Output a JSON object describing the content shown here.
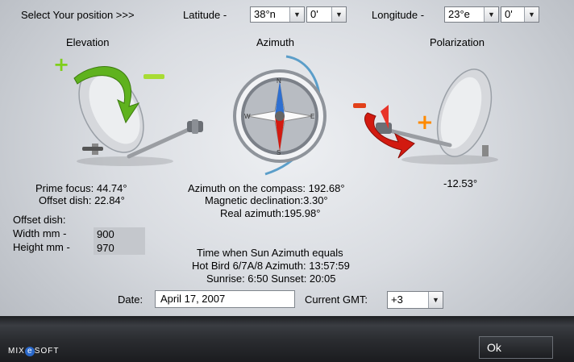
{
  "header": {
    "select_position": "Select Your position >>>",
    "latitude_label": "Latitude -",
    "latitude_deg": "38°n",
    "latitude_min": "0'",
    "longitude_label": "Longitude -",
    "longitude_deg": "23°e",
    "longitude_min": "0'"
  },
  "sections": {
    "elevation": "Elevation",
    "azimuth": "Azimuth",
    "polarization": "Polarization"
  },
  "elevation": {
    "prime_focus": "Prime focus: 44.74°",
    "offset_dish": "Offset dish: 22.84°",
    "plus": "+",
    "minus": "−"
  },
  "compass": {
    "n": "N",
    "s": "S",
    "e": "E",
    "w": "W"
  },
  "azimuth": {
    "compass": "Azimuth on the compass: 192.68°",
    "declination": "Magnetic declination:3.30°",
    "real": "Real azimuth:195.98°"
  },
  "polarization": {
    "value": "-12.53°",
    "plus": "+",
    "minus": "−"
  },
  "offset": {
    "title": "Offset dish:",
    "width_label": "Width  mm -",
    "width_value": "900",
    "height_label": "Height mm -",
    "height_value": "970"
  },
  "sun": {
    "title": "Time when Sun Azimuth equals",
    "satellite": "Hot Bird 6/7A/8 Azimuth: 13:57:59",
    "sunrise": "Sunrise: 6:50  Sunset: 20:05"
  },
  "footer": {
    "date_label": "Date:",
    "date_value": "April 17, 2007",
    "gmt_label": "Current GMT:",
    "gmt_value": "+3",
    "ok": "Ok",
    "brand_pre": "MIX",
    "brand_e": "e",
    "brand_post": "SOFT"
  },
  "colors": {
    "elevation_arrow": "#5fb21e",
    "polarization_arrow": "#d21a10",
    "plus_green": "#7fcf1a",
    "plus_orange": "#ff8a00",
    "compass_blue": "#5b9ec9"
  }
}
